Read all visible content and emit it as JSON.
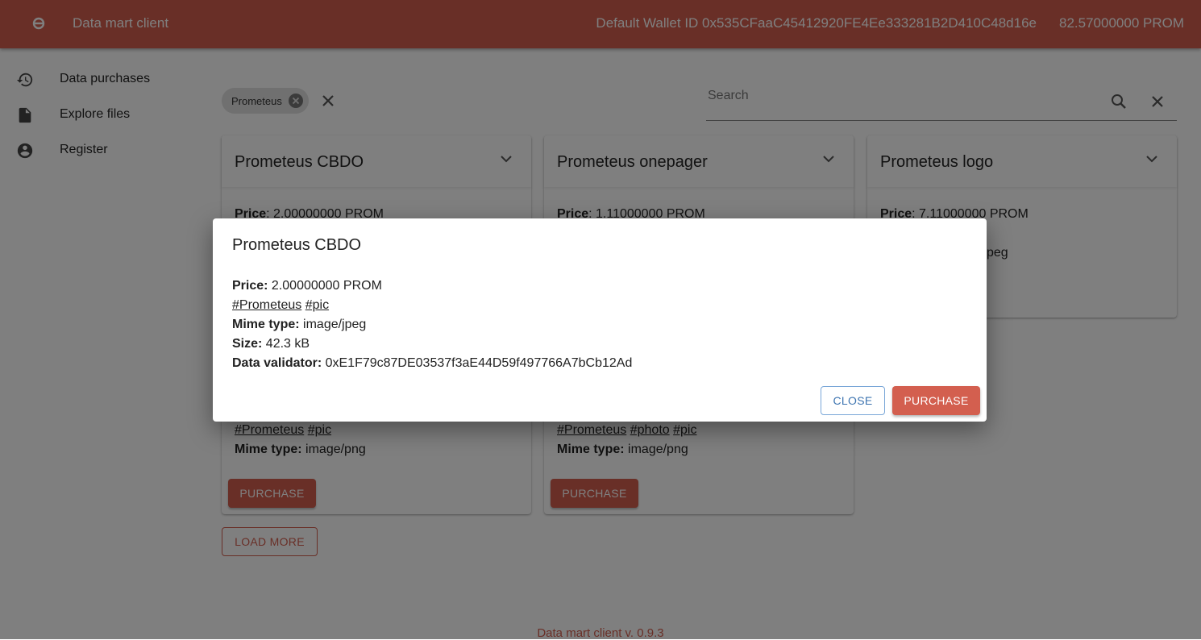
{
  "app": {
    "title": "Data mart client",
    "wallet_label": "Default Wallet ID 0x535CFaaC45412920FE4Ee333281B2D410C48d16e",
    "balance": "82.57000000 PROM",
    "footer": "Data mart client v. 0.9.3"
  },
  "sidebar": {
    "items": [
      {
        "label": "Data purchases",
        "icon": "history-icon"
      },
      {
        "label": "Explore files",
        "icon": "file-icon"
      },
      {
        "label": "Register",
        "icon": "account-icon"
      }
    ]
  },
  "filters": {
    "chip_label": "Prometeus"
  },
  "search": {
    "placeholder": "Search",
    "value": ""
  },
  "labels": {
    "price": "Price",
    "mime_type": "Mime type:",
    "size": "Size:",
    "data_validator": "Data validator:",
    "purchase": "PURCHASE",
    "close": "CLOSE",
    "load_more": "LOAD MORE"
  },
  "cards": [
    {
      "title": "Prometeus CBDO",
      "price": ": 2.00000000 PROM",
      "tags": [
        "#Prometeus",
        "#pic"
      ],
      "mime_type": "image/png"
    },
    {
      "title": "Prometeus onepager",
      "price": ": 1.11000000 PROM",
      "tags": [
        "#Prometeus",
        "#photo",
        "#pic"
      ],
      "mime_type": "image/png"
    },
    {
      "title": "Prometeus logo",
      "price": ": 7.11000000 PROM",
      "partial_mime": "/jpeg"
    }
  ],
  "dialog": {
    "title": "Prometeus CBDO",
    "price_label": "Price:",
    "price_value": "2.00000000 PROM",
    "tags": [
      "#Prometeus",
      "#pic"
    ],
    "mime_type": "image/jpeg",
    "size": "42.3 kB",
    "validator": "0xE1F79c87DE03537f3aE44D59f497766A7bCb12Ad"
  }
}
